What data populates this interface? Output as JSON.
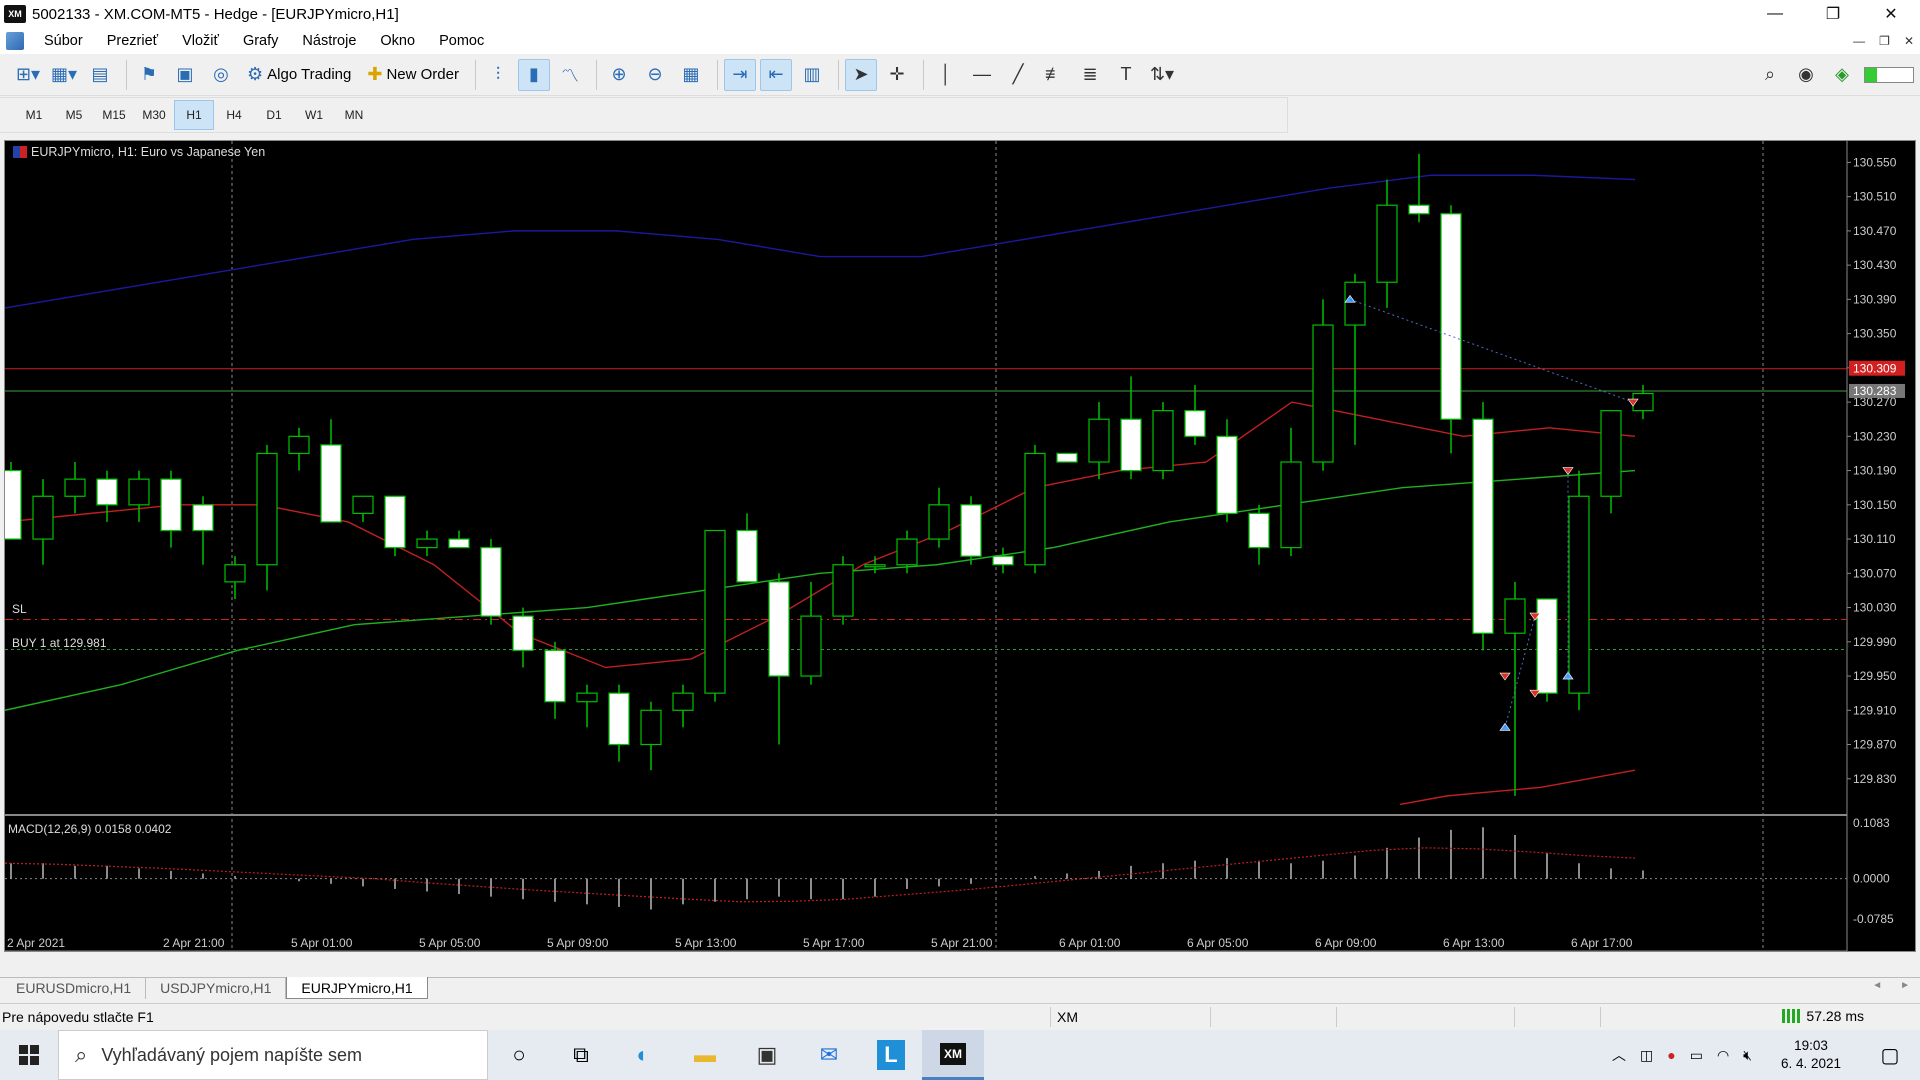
{
  "window": {
    "title": "5002133 - XM.COM-MT5 - Hedge - [EURJPYmicro,H1]",
    "logo": "XM",
    "controls": [
      "—",
      "❐",
      "✕"
    ]
  },
  "menu": {
    "items": [
      "Súbor",
      "Prezrieť",
      "Vložiť",
      "Grafy",
      "Nástroje",
      "Okno",
      "Pomoc"
    ],
    "mdi_controls": [
      "—",
      "❐",
      "✕"
    ]
  },
  "toolbar": {
    "algo_trading": "Algo Trading",
    "new_order": "New Order"
  },
  "timeframes": {
    "items": [
      "M1",
      "M5",
      "M15",
      "M30",
      "H1",
      "H4",
      "D1",
      "W1",
      "MN"
    ],
    "active": "H1"
  },
  "chart": {
    "title": "EURJPYmicro, H1:  Euro vs Japanese Yen",
    "sl_label": "SL",
    "buy_label": "BUY 1 at 129.981",
    "macd_label": "MACD(12,26,9) 0.0158 0.0402",
    "bid_price_label": "130.309",
    "ask_price_label": "130.283",
    "colors": {
      "bull_candle": "#000000",
      "bear_candle": "#ffffff",
      "wick": "#00c000",
      "envelope_upper": "#1a1aa0",
      "envelope_lower": "#c02020",
      "ma_fast": "#c02020",
      "ma_slow": "#20b020",
      "bid_line": "#d02020",
      "ask_line": "#40a040"
    }
  },
  "chart_data": {
    "type": "candlestick",
    "symbol": "EURJPYmicro",
    "timeframe": "H1",
    "ylim": [
      129.79,
      130.575
    ],
    "price_ticks": [
      130.55,
      130.51,
      130.47,
      130.43,
      130.39,
      130.35,
      130.31,
      130.27,
      130.23,
      130.19,
      130.15,
      130.11,
      130.07,
      130.03,
      129.99,
      129.95,
      129.91,
      129.87,
      129.83
    ],
    "price_tick_labels": [
      "130.550",
      "130.510",
      "130.470",
      "130.430",
      "130.390",
      "130.350",
      "",
      "130.270",
      "130.230",
      "130.190",
      "130.150",
      "130.110",
      "130.070",
      "130.030",
      "129.990",
      "129.950",
      "129.910",
      "129.870",
      "129.830"
    ],
    "time_labels": [
      "2 Apr 2021",
      "2 Apr 21:00",
      "5 Apr 01:00",
      "5 Apr 05:00",
      "5 Apr 09:00",
      "5 Apr 13:00",
      "5 Apr 17:00",
      "5 Apr 21:00",
      "6 Apr 01:00",
      "6 Apr 05:00",
      "6 Apr 09:00",
      "6 Apr 13:00",
      "6 Apr 17:00"
    ],
    "candles": [
      {
        "o": 130.19,
        "h": 130.2,
        "l": 130.11,
        "c": 130.11
      },
      {
        "o": 130.11,
        "h": 130.18,
        "l": 130.08,
        "c": 130.16
      },
      {
        "o": 130.16,
        "h": 130.2,
        "l": 130.14,
        "c": 130.18
      },
      {
        "o": 130.18,
        "h": 130.19,
        "l": 130.13,
        "c": 130.15
      },
      {
        "o": 130.15,
        "h": 130.19,
        "l": 130.13,
        "c": 130.18
      },
      {
        "o": 130.18,
        "h": 130.19,
        "l": 130.1,
        "c": 130.12
      },
      {
        "o": 130.15,
        "h": 130.16,
        "l": 130.08,
        "c": 130.12
      },
      {
        "o": 130.06,
        "h": 130.09,
        "l": 130.04,
        "c": 130.08
      },
      {
        "o": 130.08,
        "h": 130.22,
        "l": 130.05,
        "c": 130.21
      },
      {
        "o": 130.21,
        "h": 130.24,
        "l": 130.19,
        "c": 130.23
      },
      {
        "o": 130.22,
        "h": 130.25,
        "l": 130.13,
        "c": 130.13
      },
      {
        "o": 130.14,
        "h": 130.16,
        "l": 130.13,
        "c": 130.16
      },
      {
        "o": 130.16,
        "h": 130.16,
        "l": 130.09,
        "c": 130.1
      },
      {
        "o": 130.1,
        "h": 130.12,
        "l": 130.09,
        "c": 130.11
      },
      {
        "o": 130.11,
        "h": 130.12,
        "l": 130.1,
        "c": 130.1
      },
      {
        "o": 130.1,
        "h": 130.11,
        "l": 130.01,
        "c": 130.02
      },
      {
        "o": 130.02,
        "h": 130.03,
        "l": 129.96,
        "c": 129.98
      },
      {
        "o": 129.98,
        "h": 129.99,
        "l": 129.9,
        "c": 129.92
      },
      {
        "o": 129.92,
        "h": 129.94,
        "l": 129.89,
        "c": 129.93
      },
      {
        "o": 129.93,
        "h": 129.94,
        "l": 129.85,
        "c": 129.87
      },
      {
        "o": 129.87,
        "h": 129.92,
        "l": 129.84,
        "c": 129.91
      },
      {
        "o": 129.91,
        "h": 129.94,
        "l": 129.89,
        "c": 129.93
      },
      {
        "o": 129.93,
        "h": 130.12,
        "l": 129.92,
        "c": 130.12
      },
      {
        "o": 130.12,
        "h": 130.14,
        "l": 130.06,
        "c": 130.06
      },
      {
        "o": 130.06,
        "h": 130.07,
        "l": 129.87,
        "c": 129.95
      },
      {
        "o": 129.95,
        "h": 130.06,
        "l": 129.94,
        "c": 130.02
      },
      {
        "o": 130.02,
        "h": 130.09,
        "l": 130.01,
        "c": 130.08
      },
      {
        "o": 130.08,
        "h": 130.09,
        "l": 130.07,
        "c": 130.08
      },
      {
        "o": 130.08,
        "h": 130.12,
        "l": 130.07,
        "c": 130.11
      },
      {
        "o": 130.11,
        "h": 130.17,
        "l": 130.1,
        "c": 130.15
      },
      {
        "o": 130.15,
        "h": 130.16,
        "l": 130.08,
        "c": 130.09
      },
      {
        "o": 130.09,
        "h": 130.1,
        "l": 130.07,
        "c": 130.08
      },
      {
        "o": 130.08,
        "h": 130.22,
        "l": 130.07,
        "c": 130.21
      },
      {
        "o": 130.21,
        "h": 130.21,
        "l": 130.2,
        "c": 130.2
      },
      {
        "o": 130.2,
        "h": 130.27,
        "l": 130.18,
        "c": 130.25
      },
      {
        "o": 130.25,
        "h": 130.3,
        "l": 130.18,
        "c": 130.19
      },
      {
        "o": 130.19,
        "h": 130.27,
        "l": 130.18,
        "c": 130.26
      },
      {
        "o": 130.26,
        "h": 130.29,
        "l": 130.22,
        "c": 130.23
      },
      {
        "o": 130.23,
        "h": 130.25,
        "l": 130.13,
        "c": 130.14
      },
      {
        "o": 130.14,
        "h": 130.15,
        "l": 130.08,
        "c": 130.1
      },
      {
        "o": 130.1,
        "h": 130.24,
        "l": 130.09,
        "c": 130.2
      },
      {
        "o": 130.2,
        "h": 130.39,
        "l": 130.19,
        "c": 130.36
      },
      {
        "o": 130.36,
        "h": 130.42,
        "l": 130.22,
        "c": 130.41
      },
      {
        "o": 130.41,
        "h": 130.53,
        "l": 130.38,
        "c": 130.5
      },
      {
        "o": 130.5,
        "h": 130.56,
        "l": 130.48,
        "c": 130.49
      },
      {
        "o": 130.49,
        "h": 130.5,
        "l": 130.21,
        "c": 130.25
      },
      {
        "o": 130.25,
        "h": 130.27,
        "l": 129.98,
        "c": 130.0
      },
      {
        "o": 130.0,
        "h": 130.06,
        "l": 129.81,
        "c": 130.04
      },
      {
        "o": 130.04,
        "h": 130.04,
        "l": 129.92,
        "c": 129.93
      },
      {
        "o": 129.93,
        "h": 130.19,
        "l": 129.91,
        "c": 130.16
      },
      {
        "o": 130.16,
        "h": 130.26,
        "l": 130.14,
        "c": 130.26
      },
      {
        "o": 130.26,
        "h": 130.29,
        "l": 130.25,
        "c": 130.28
      }
    ],
    "indicators": {
      "bands_upper": [
        130.38,
        130.4,
        130.42,
        130.44,
        130.46,
        130.47,
        130.47,
        130.46,
        130.44,
        130.44,
        130.46,
        130.48,
        130.5,
        130.52,
        130.535,
        130.535,
        130.53
      ],
      "bands_lower": [
        129.8,
        129.81,
        129.815,
        129.82,
        129.83,
        129.84
      ],
      "ma_fast": [
        130.13,
        130.14,
        130.15,
        130.15,
        130.13,
        130.08,
        130.0,
        129.96,
        129.97,
        130.02,
        130.08,
        130.12,
        130.17,
        130.19,
        130.2,
        130.27,
        130.25,
        130.23,
        130.24,
        130.23
      ],
      "ma_slow": [
        129.91,
        129.94,
        129.98,
        130.01,
        130.02,
        130.03,
        130.05,
        130.07,
        130.08,
        130.1,
        130.13,
        130.15,
        130.17,
        130.18,
        130.19
      ]
    },
    "macd": {
      "ticks": [
        "0.1083",
        "0.0000",
        "-0.0785"
      ],
      "ylim": [
        -0.0785,
        0.1083
      ],
      "histogram": [
        0.03,
        0.03,
        0.025,
        0.025,
        0.02,
        0.015,
        0.01,
        0.005,
        0,
        -0.005,
        -0.01,
        -0.015,
        -0.02,
        -0.025,
        -0.03,
        -0.035,
        -0.04,
        -0.045,
        -0.05,
        -0.055,
        -0.06,
        -0.05,
        -0.045,
        -0.04,
        -0.035,
        -0.04,
        -0.04,
        -0.035,
        -0.02,
        -0.015,
        -0.01,
        0,
        0.005,
        0.01,
        0.015,
        0.025,
        0.03,
        0.035,
        0.04,
        0.035,
        0.03,
        0.035,
        0.045,
        0.06,
        0.08,
        0.095,
        0.1,
        0.085,
        0.05,
        0.03,
        0.02,
        0.016
      ],
      "signal": [
        0.03,
        0.028,
        0.024,
        0.02,
        0.015,
        0.01,
        0.005,
        0,
        -0.008,
        -0.015,
        -0.022,
        -0.028,
        -0.034,
        -0.04,
        -0.045,
        -0.044,
        -0.04,
        -0.032,
        -0.024,
        -0.015,
        -0.005,
        0.005,
        0.015,
        0.025,
        0.035,
        0.045,
        0.055,
        0.06,
        0.058,
        0.052,
        0.045,
        0.04
      ]
    },
    "levels": {
      "bid": 130.309,
      "ask": 130.283,
      "sl": 130.016,
      "buy": 129.981
    }
  },
  "tabs": {
    "items": [
      "EURUSDmicro,H1",
      "USDJPYmicro,H1",
      "EURJPYmicro,H1"
    ],
    "active": "EURJPYmicro,H1",
    "nav": [
      "◄",
      "►"
    ]
  },
  "status": {
    "help": "Pre nápovedu stlačte F1",
    "profile": "XM",
    "ping": "57.28 ms"
  },
  "taskbar": {
    "search_placeholder": "Vyhľadávaný pojem napíšte sem",
    "time": "19:03",
    "date": "6. 4. 2021"
  }
}
